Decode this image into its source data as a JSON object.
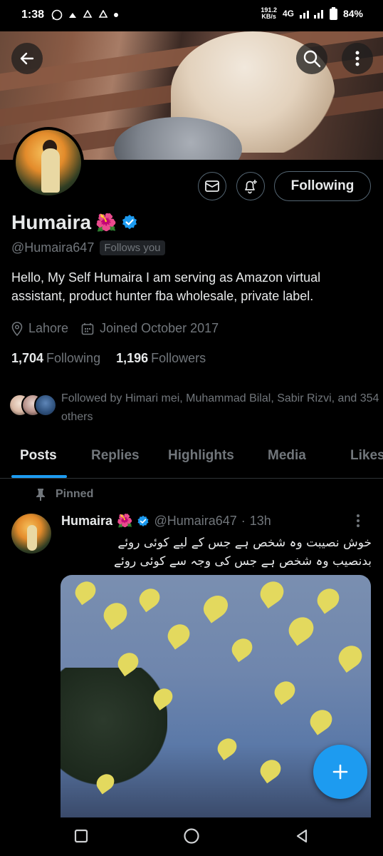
{
  "status_bar": {
    "time": "1:38",
    "net_speed_value": "191.2",
    "net_speed_unit": "KB/s",
    "network": "4G",
    "battery": "84%"
  },
  "profile": {
    "name": "Humaira",
    "name_emoji": "🌺",
    "handle": "@Humaira647",
    "follows_you": "Follows you",
    "bio": "Hello, My Self Humaira  I am serving as Amazon virtual assistant, product hunter fba wholesale, private label.",
    "location": "Lahore",
    "joined": "Joined October 2017",
    "following_count": "1,704",
    "following_label": "Following",
    "followers_count": "1,196",
    "followers_label": "Followers",
    "followed_by": "Followed by Himari mei, Muhammad Bilal, Sabir Rizvi, and 354 others",
    "following_button": "Following"
  },
  "tabs": [
    "Posts",
    "Replies",
    "Highlights",
    "Media",
    "Likes"
  ],
  "pinned_label": "Pinned",
  "post": {
    "name": "Humaira",
    "name_emoji": "🌺",
    "handle": "@Humaira647",
    "separator": "·",
    "time": "13h",
    "line1": "خوش نصیبت وہ شخص ہے جس کے لیے کوئی روئے",
    "line2": "بدنصیب وہ شخص ہے جس کی وجہ سے کوئی روئے"
  },
  "colors": {
    "accent": "#1d9bf0",
    "verified": "#1d9bf0",
    "text_primary": "#e7e9ea",
    "text_secondary": "#71767b"
  },
  "icons": [
    "back-arrow-icon",
    "search-icon",
    "more-vertical-icon",
    "mail-icon",
    "bell-plus-icon",
    "verified-badge-icon",
    "location-pin-icon",
    "calendar-icon",
    "pin-icon",
    "plus-icon",
    "nav-recent-icon",
    "nav-home-icon",
    "nav-back-icon"
  ]
}
